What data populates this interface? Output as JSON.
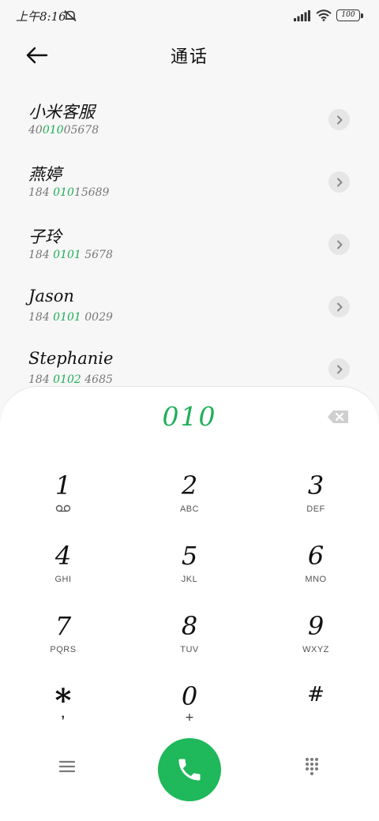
{
  "status": {
    "time": "上午8:16",
    "battery": "100"
  },
  "header": {
    "title": "通话"
  },
  "contacts": [
    {
      "name": "小米客服",
      "number_parts": [
        "40",
        "010",
        "05678"
      ]
    },
    {
      "name": "燕婷",
      "number_parts": [
        "184 ",
        "010",
        "15689"
      ]
    },
    {
      "name": "子玲",
      "number_parts": [
        "184 ",
        "0101",
        " 5678"
      ]
    },
    {
      "name": "Jason",
      "number_parts": [
        "184 ",
        "0101",
        " 0029"
      ]
    },
    {
      "name": "Stephanie",
      "number_parts": [
        "184 ",
        "0102",
        " 4685"
      ]
    }
  ],
  "dialer": {
    "input": "010",
    "keys": [
      {
        "digit": "1",
        "letters": ""
      },
      {
        "digit": "2",
        "letters": "ABC"
      },
      {
        "digit": "3",
        "letters": "DEF"
      },
      {
        "digit": "4",
        "letters": "GHI"
      },
      {
        "digit": "5",
        "letters": "JKL"
      },
      {
        "digit": "6",
        "letters": "MNO"
      },
      {
        "digit": "7",
        "letters": "PQRS"
      },
      {
        "digit": "8",
        "letters": "TUV"
      },
      {
        "digit": "9",
        "letters": "WXYZ"
      },
      {
        "digit": "*",
        "letters": ","
      },
      {
        "digit": "0",
        "letters": "+"
      },
      {
        "digit": "#",
        "letters": ""
      }
    ]
  },
  "colors": {
    "accent_green": "#1fae58",
    "call_button": "#1fb85a"
  },
  "icons": {
    "back": "back-arrow-icon",
    "detail": "chevron-right-icon",
    "backspace": "backspace-icon",
    "voicemail": "voicemail-icon",
    "menu": "menu-icon",
    "call": "phone-icon",
    "keypad": "dialpad-icon"
  }
}
